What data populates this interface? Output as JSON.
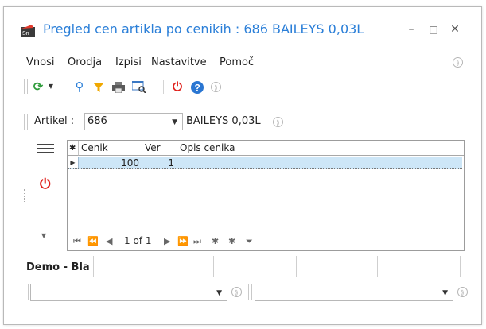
{
  "window": {
    "title": "Pregled cen artikla po cenikih : 686 BAILEYS 0,03L",
    "minimize_glyph": "–",
    "maximize_glyph": "□",
    "close_glyph": "✕"
  },
  "menu": {
    "items": [
      {
        "label": "Vnosi"
      },
      {
        "label": "Orodja"
      },
      {
        "label": "Izpisi"
      },
      {
        "label": "Nastavitve"
      },
      {
        "label": "Pomoč"
      }
    ]
  },
  "toolbar": {
    "icons": [
      "refresh-icon",
      "search-icon",
      "filter-icon",
      "print-icon",
      "preview-icon",
      "power-icon",
      "help-icon"
    ]
  },
  "article": {
    "label": "Artikel :",
    "code": "686",
    "name": "BAILEYS 0,03L"
  },
  "grid": {
    "columns": [
      "Cenik",
      "Ver",
      "Opis cenika"
    ],
    "rows": [
      {
        "cenik": "100",
        "ver": "1",
        "opis": ""
      }
    ],
    "page_info": "1 of 1"
  },
  "footer": {
    "tab_label": "Demo - Bla"
  },
  "colors": {
    "accent": "#2b7fd8",
    "row_selected": "#cde6f7",
    "power_red": "#e0201b"
  }
}
